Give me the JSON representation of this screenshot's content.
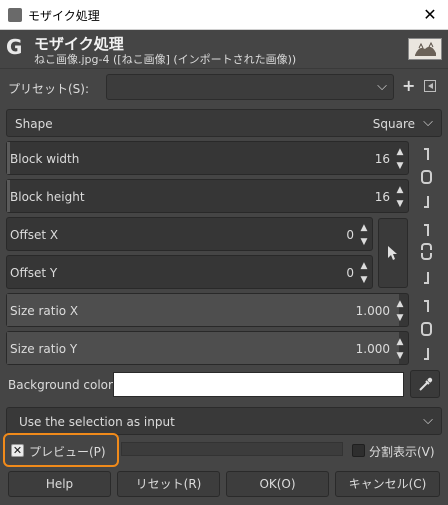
{
  "window": {
    "title": "モザイク処理",
    "close_glyph": "✕"
  },
  "header": {
    "logo": "G",
    "title": "モザイク処理",
    "subtitle": "ねこ画像.jpg-4 ([ねこ画像] (インポートされた画像))"
  },
  "presets": {
    "label": "プリセット(S):",
    "value": "",
    "add_glyph": "+"
  },
  "shape": {
    "label": "Shape",
    "value": "Square"
  },
  "block": {
    "width_label": "Block width",
    "width_value": "16",
    "height_label": "Block height",
    "height_value": "16"
  },
  "offset": {
    "x_label": "Offset X",
    "x_value": "0",
    "y_label": "Offset Y",
    "y_value": "0"
  },
  "size_ratio": {
    "x_label": "Size ratio X",
    "x_value": "1.000",
    "y_label": "Size ratio Y",
    "y_value": "1.000"
  },
  "background": {
    "label": "Background color",
    "color": "#ffffff"
  },
  "input_source": {
    "value": "Use the selection as input"
  },
  "preview": {
    "label": "プレビュー(P)",
    "checked": true,
    "check_glyph": "✕"
  },
  "split_view": {
    "label": "分割表示(V)",
    "checked": false
  },
  "buttons": {
    "help": "Help",
    "reset": "リセット(R)",
    "ok": "OK(O)",
    "cancel": "キャンセル(C)"
  },
  "colors": {
    "dialog_bg": "#454545",
    "highlight": "#f08a1a"
  }
}
